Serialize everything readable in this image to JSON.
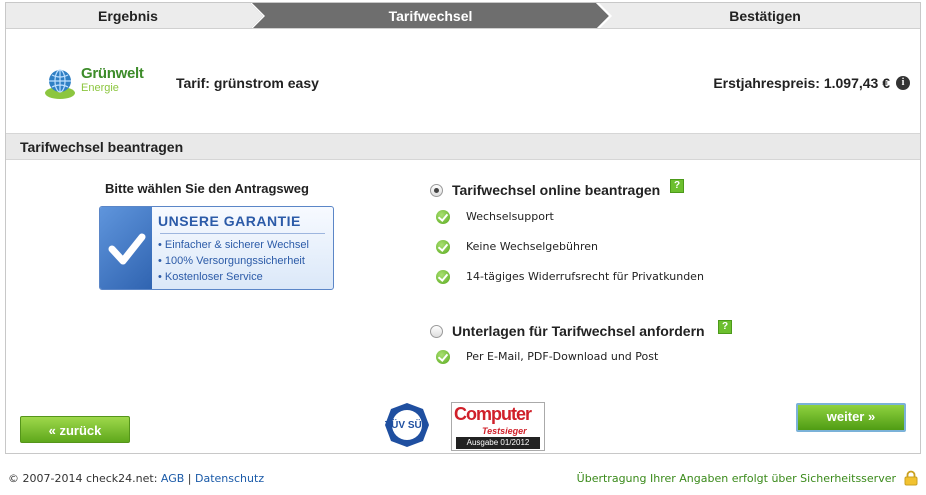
{
  "steps": [
    {
      "label": "Ergebnis",
      "active": false
    },
    {
      "label": "Tarifwechsel",
      "active": true
    },
    {
      "label": "Bestätigen",
      "active": false
    }
  ],
  "header": {
    "logo_line1": "Grünwelt",
    "logo_line2": "Energie",
    "tarif": "Tarif: grünstrom easy",
    "price": "Erstjahrespreis: 1.097,43 €",
    "info_icon": "info-icon"
  },
  "section": {
    "title": "Tarifwechsel beantragen"
  },
  "left": {
    "choose_label": "Bitte wählen Sie den Antragsweg",
    "guarantee": {
      "title": "UNSERE GARANTIE",
      "items": [
        "• Einfacher & sicherer Wechsel",
        "• 100% Versorgungssicherheit",
        "• Kostenloser Service"
      ]
    }
  },
  "options": [
    {
      "label": "Tarifwechsel online beantragen",
      "selected": true,
      "features": [
        "Wechselsupport",
        "Keine Wechselgebühren",
        "14-tägiges Widerrufsrecht für Privatkunden"
      ]
    },
    {
      "label": "Unterlagen für Tarifwechsel anfordern",
      "selected": false,
      "features": [
        "Per E-Mail, PDF-Download und Post"
      ]
    }
  ],
  "buttons": {
    "back": "« zurück",
    "next": "weiter »"
  },
  "badges": {
    "tuv": "TÜV SÜD",
    "computerbild_top": "Computer",
    "computerbild_mid": "Testsieger",
    "computerbild_bot": "Ausgabe 01/2012"
  },
  "footer": {
    "copyright": "© 2007-2014 check24.net: ",
    "agb": "AGB",
    "sep": " | ",
    "datenschutz": "Datenschutz",
    "secure": "Übertragung Ihrer Angaben erfolgt über Sicherheitsserver"
  },
  "colors": {
    "accent_green": "#5fa81c",
    "step_active": "#6e6e6e",
    "guarantee_blue": "#2c5ba8"
  }
}
